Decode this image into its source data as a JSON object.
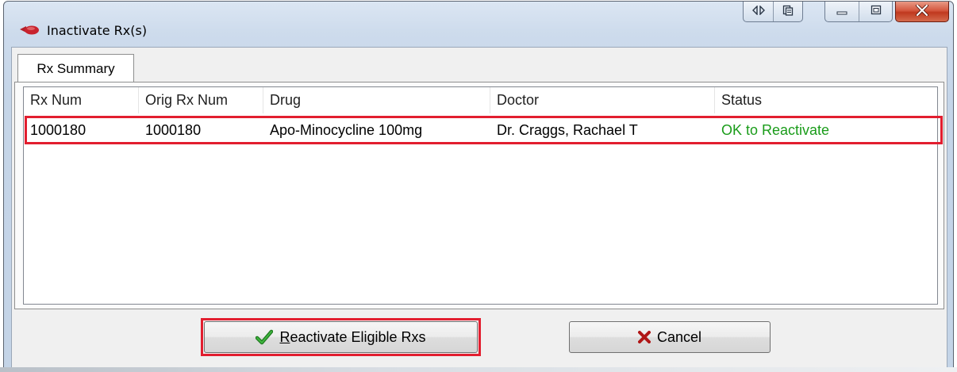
{
  "window": {
    "title": "Inactivate Rx(s)",
    "icon": "pill-icon"
  },
  "tabs": [
    {
      "label": "Rx Summary",
      "active": true
    }
  ],
  "table": {
    "columns": [
      "Rx Num",
      "Orig Rx Num",
      "Drug",
      "Doctor",
      "Status"
    ],
    "rows": [
      [
        "1000180",
        "1000180",
        "Apo-Minocycline 100mg",
        "Dr. Craggs, Rachael T",
        "OK to Reactivate"
      ]
    ]
  },
  "buttons": {
    "reactivate": {
      "label": "Reactivate Eligible Rxs",
      "mnemonic": "R",
      "rest": "eactivate Eligible Rxs",
      "icon": "checkmark-icon"
    },
    "cancel": {
      "label": "Cancel",
      "icon": "x-icon"
    }
  },
  "colors": {
    "highlight_border": "#e21e2f",
    "status_ok": "#1a9c1a",
    "close_button": "#c73d22"
  }
}
